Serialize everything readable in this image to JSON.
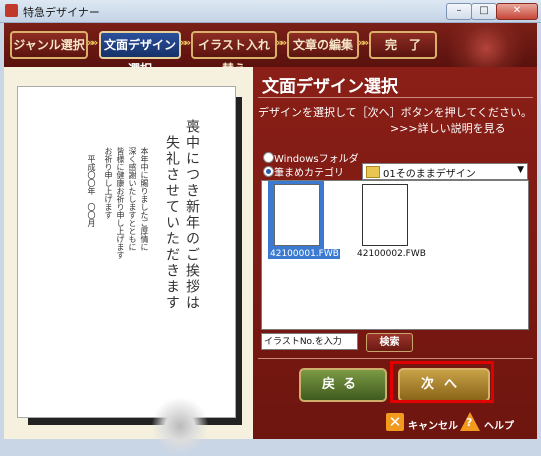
{
  "window": {
    "title": "特急デザイナー",
    "min_label": "–",
    "max_label": "□",
    "close_label": "✕"
  },
  "steps": [
    {
      "label": "ジャンル選択"
    },
    {
      "label": "文面デザイン選択"
    },
    {
      "label": "イラスト入れ替え"
    },
    {
      "label": "文章の編集"
    },
    {
      "label": "完　了"
    }
  ],
  "preview": {
    "col1": "喪中につき新年のご挨拶は",
    "col2": "失礼させていただきます",
    "col3": "本年中に賜りましたご厚情に",
    "col4": "深く感謝いたしますとともに",
    "col5": "皆様に健康お祈り申し上げます",
    "col6": "お祈り申し上げます",
    "date": "平成〇〇年　〇〇月"
  },
  "panel": {
    "title": "文面デザイン選択",
    "description": "デザインを選択して［次へ］ボタンを押してください。",
    "more_link": ">>>詳しい説明を見る",
    "radio_windows": "Windowsフォルダ",
    "radio_collection": "筆まめカテゴリ",
    "dropdown_value": "01そのままデザイン",
    "dropdown_arrow": "▼",
    "thumbnails": [
      {
        "label": "42100001.FWB",
        "selected": true
      },
      {
        "label": "42100002.FWB",
        "selected": false
      }
    ],
    "search_placeholder": "イラストNo.を入力",
    "search_button": "検索",
    "back_button": "戻る",
    "next_button": "次へ",
    "cancel_label": "キャンセル",
    "help_label": "ヘルプ"
  },
  "colors": {
    "accent_red": "#7a1f18",
    "highlight": "#e00000",
    "active_step": "#2a4f9c"
  }
}
